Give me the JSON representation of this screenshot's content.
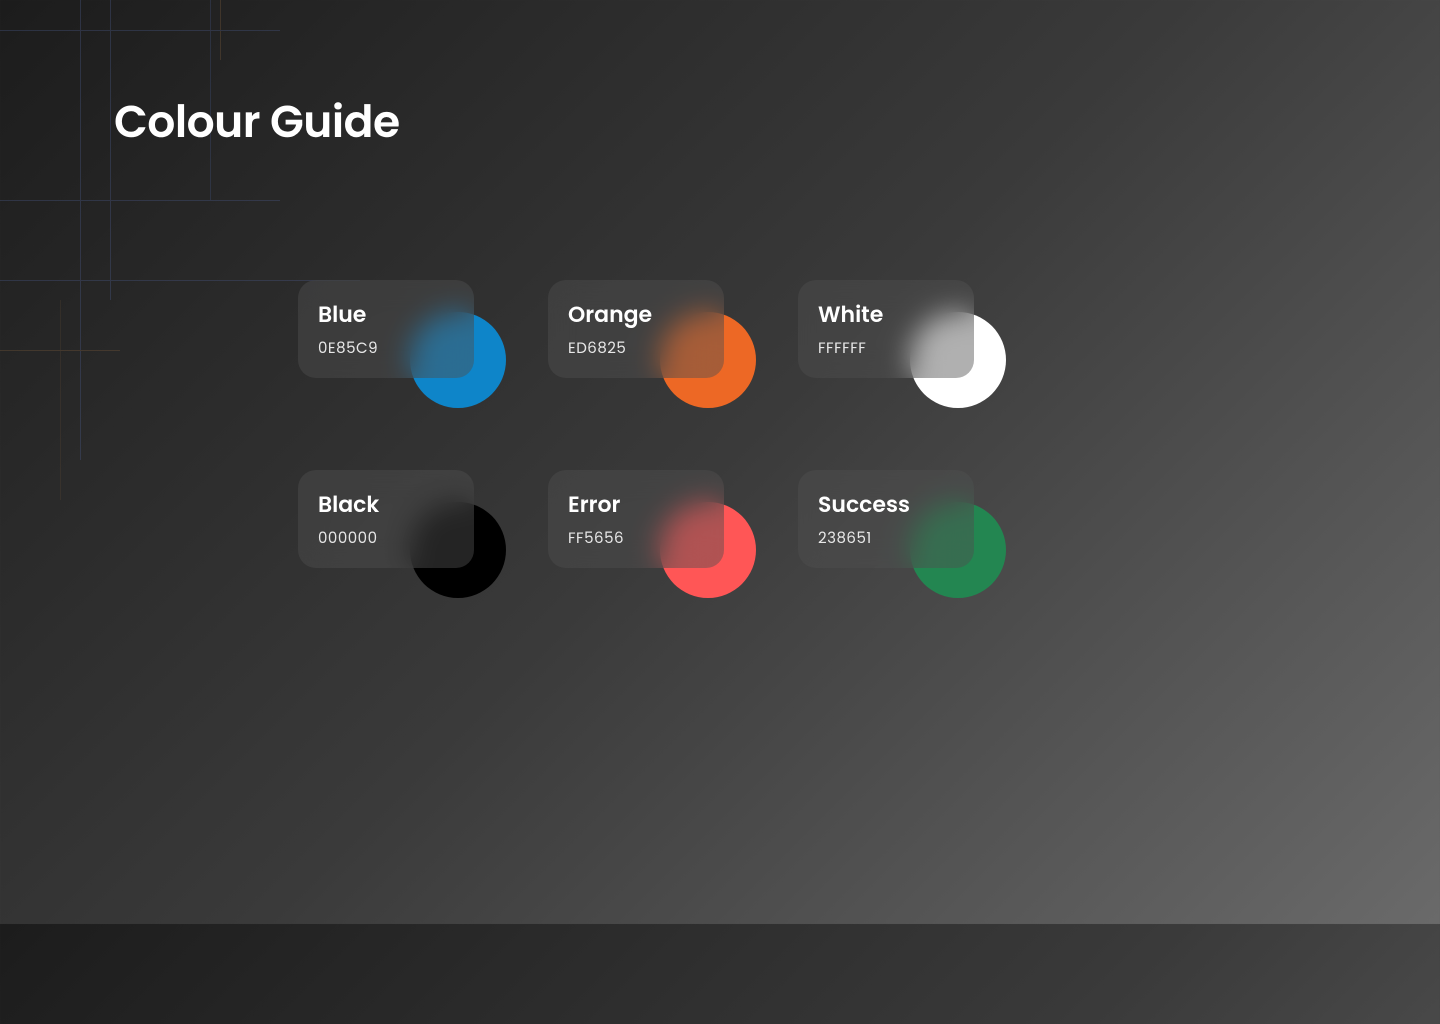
{
  "title": "Colour Guide",
  "swatches": [
    {
      "name": "Blue",
      "hex": "0E85C9",
      "color": "#0E85C9"
    },
    {
      "name": "Orange",
      "hex": "ED6825",
      "color": "#ED6825"
    },
    {
      "name": "White",
      "hex": "FFFFFF",
      "color": "#FFFFFF"
    },
    {
      "name": "Black",
      "hex": "000000",
      "color": "#000000"
    },
    {
      "name": "Error",
      "hex": "FF5656",
      "color": "#FF5656"
    },
    {
      "name": "Success",
      "hex": "238651",
      "color": "#238651"
    }
  ]
}
